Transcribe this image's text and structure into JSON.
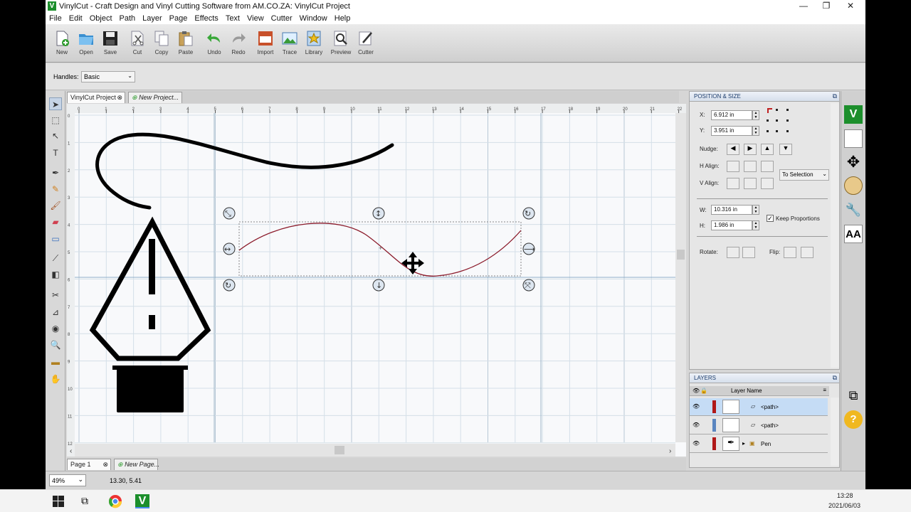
{
  "window": {
    "title": "VinylCut - Craft Design and Vinyl Cutting Software from AM.CO.ZA: VinylCut Project",
    "app_icon": "V",
    "minimize": "—",
    "restore": "❐",
    "close": "✕"
  },
  "menu": [
    "File",
    "Edit",
    "Object",
    "Path",
    "Layer",
    "Page",
    "Effects",
    "Text",
    "View",
    "Cutter",
    "Window",
    "Help"
  ],
  "toolbar": [
    {
      "label": "New",
      "icon": "new-icon"
    },
    {
      "label": "Open",
      "icon": "open-icon"
    },
    {
      "label": "Save",
      "icon": "save-icon"
    },
    {
      "label": "Cut",
      "icon": "cut-icon"
    },
    {
      "label": "Copy",
      "icon": "copy-icon"
    },
    {
      "label": "Paste",
      "icon": "paste-icon"
    },
    {
      "label": "Undo",
      "icon": "undo-icon"
    },
    {
      "label": "Redo",
      "icon": "redo-icon"
    },
    {
      "label": "Import",
      "icon": "import-icon",
      "badge": "SVG"
    },
    {
      "label": "Trace",
      "icon": "trace-icon"
    },
    {
      "label": "Library",
      "icon": "library-icon"
    },
    {
      "label": "Preview",
      "icon": "preview-icon"
    },
    {
      "label": "Cutter",
      "icon": "cutter-icon"
    }
  ],
  "options": {
    "handles_label": "Handles:",
    "handles_value": "Basic"
  },
  "tabs": {
    "project": "VinylCut Project",
    "new_project": "New Project..."
  },
  "ruler": {
    "h": [
      "0",
      "1",
      "2",
      "3",
      "4",
      "5",
      "6",
      "7",
      "8",
      "9",
      "10",
      "11",
      "12",
      "13",
      "14",
      "15",
      "16",
      "17",
      "18",
      "19",
      "20",
      "21",
      "22"
    ],
    "v": [
      "0",
      "1",
      "2",
      "3",
      "4",
      "5",
      "6",
      "7",
      "8",
      "9",
      "10",
      "11",
      "12"
    ]
  },
  "pages": {
    "page": "Page 1",
    "new_page": "New Page..."
  },
  "status": {
    "zoom": "49%",
    "coords": "13.30, 5.41"
  },
  "position_size": {
    "title": "POSITION & SIZE",
    "x_label": "X:",
    "x_value": "6.912 in",
    "y_label": "Y:",
    "y_value": "3.951 in",
    "nudge": "Nudge:",
    "halign": "H Align:",
    "valign": "V Align:",
    "to_selection": "To Selection",
    "w_label": "W:",
    "w_value": "10.316 in",
    "h_label": "H:",
    "h_value": "1.986 in",
    "keep_proportions": "Keep Proportions",
    "keep_checked": true,
    "rotate": "Rotate:",
    "flip": "Flip:"
  },
  "layers": {
    "title": "LAYERS",
    "col_name": "Layer Name",
    "rows": [
      {
        "name": "<path>",
        "color": "#b01818",
        "selected": true
      },
      {
        "name": "<path>",
        "color": "#5a86c0",
        "selected": false
      },
      {
        "name": "Pen",
        "color": "#b01818",
        "selected": false
      }
    ]
  },
  "right_strip": [
    "vinylcut-logo-icon",
    "page-icon",
    "move-icon",
    "palette-icon",
    "wrench-icon",
    "text-aa-icon",
    "layers-icon",
    "help-icon"
  ],
  "right_strip_text": {
    "aa": "AA",
    "help": "?"
  },
  "taskbar": {
    "time": "13:28",
    "date": "2021/06/03"
  },
  "colors": {
    "accent": "#1c8f2c",
    "selection_curve": "#8b1a2a",
    "grid": "#cfdbe6"
  }
}
